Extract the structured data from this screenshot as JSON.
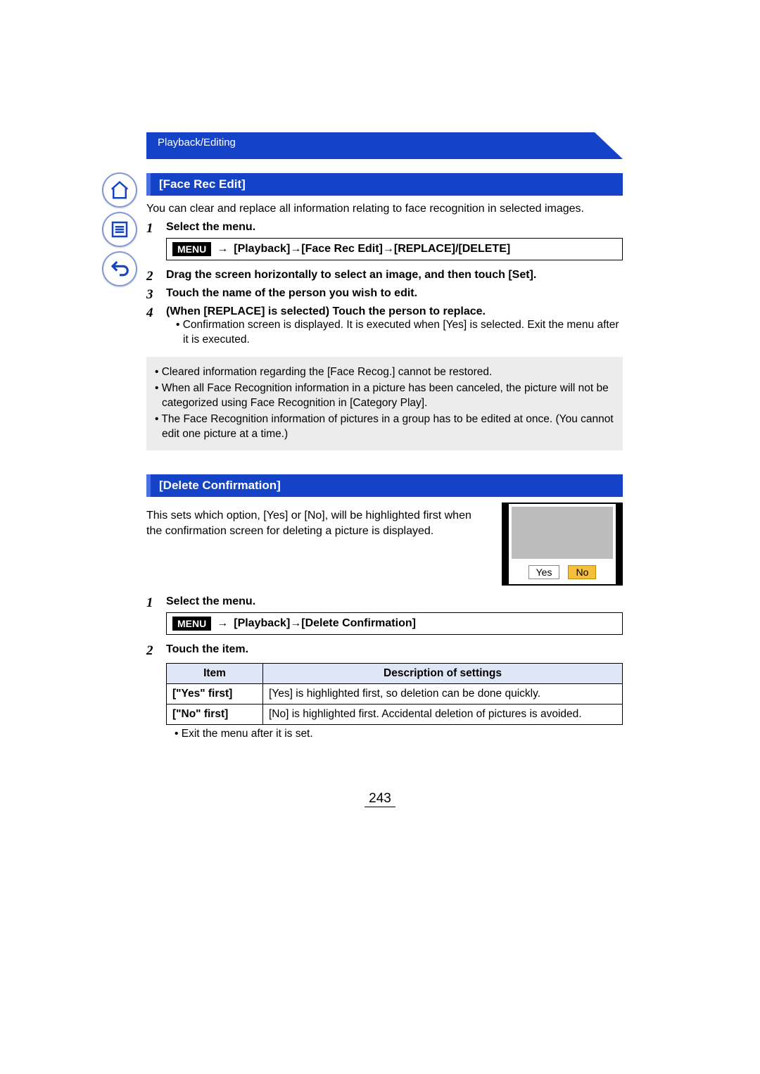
{
  "header": {
    "breadcrumb": "Playback/Editing"
  },
  "nav": {
    "home": "home-icon",
    "toc": "list-icon",
    "back": "back-arrow-icon"
  },
  "section1": {
    "title": "[Face Rec Edit]",
    "intro": "You can clear and replace all information relating to face recognition in selected images.",
    "steps": [
      {
        "num": "1",
        "title": "Select the menu.",
        "menu_label": "MENU",
        "path": "[Playback]→[Face Rec Edit]→[REPLACE]/[DELETE]"
      },
      {
        "num": "2",
        "title": "Drag the screen horizontally to select an image, and then touch [Set]."
      },
      {
        "num": "3",
        "title": "Touch the name of the person you wish to edit."
      },
      {
        "num": "4",
        "title": "(When [REPLACE] is selected) Touch the person to replace.",
        "sub": [
          "• Confirmation screen is displayed. It is executed when [Yes] is selected. Exit the menu after it is executed."
        ]
      }
    ],
    "notes": [
      "• Cleared information regarding the [Face Recog.] cannot be restored.",
      "• When all Face Recognition information in a picture has been canceled, the picture will not be categorized using Face Recognition in [Category Play].",
      "• The Face Recognition information of pictures in a group has to be edited at once. (You cannot edit one picture at a time.)"
    ]
  },
  "section2": {
    "title": "[Delete Confirmation]",
    "intro": "This sets which option, [Yes] or [No], will be highlighted first when the confirmation screen for deleting a picture is displayed.",
    "dialog": {
      "yes": "Yes",
      "no": "No"
    },
    "steps": [
      {
        "num": "1",
        "title": "Select the menu.",
        "menu_label": "MENU",
        "path": "[Playback]→[Delete Confirmation]"
      },
      {
        "num": "2",
        "title": "Touch the item."
      }
    ],
    "table": {
      "headers": [
        "Item",
        "Description of settings"
      ],
      "rows": [
        {
          "item": "[\"Yes\" first]",
          "desc": "[Yes] is highlighted first, so deletion can be done quickly."
        },
        {
          "item": "[\"No\" first]",
          "desc": "[No] is highlighted first. Accidental deletion of pictures is avoided."
        }
      ]
    },
    "after_table": "• Exit the menu after it is set."
  },
  "page_number": "243"
}
